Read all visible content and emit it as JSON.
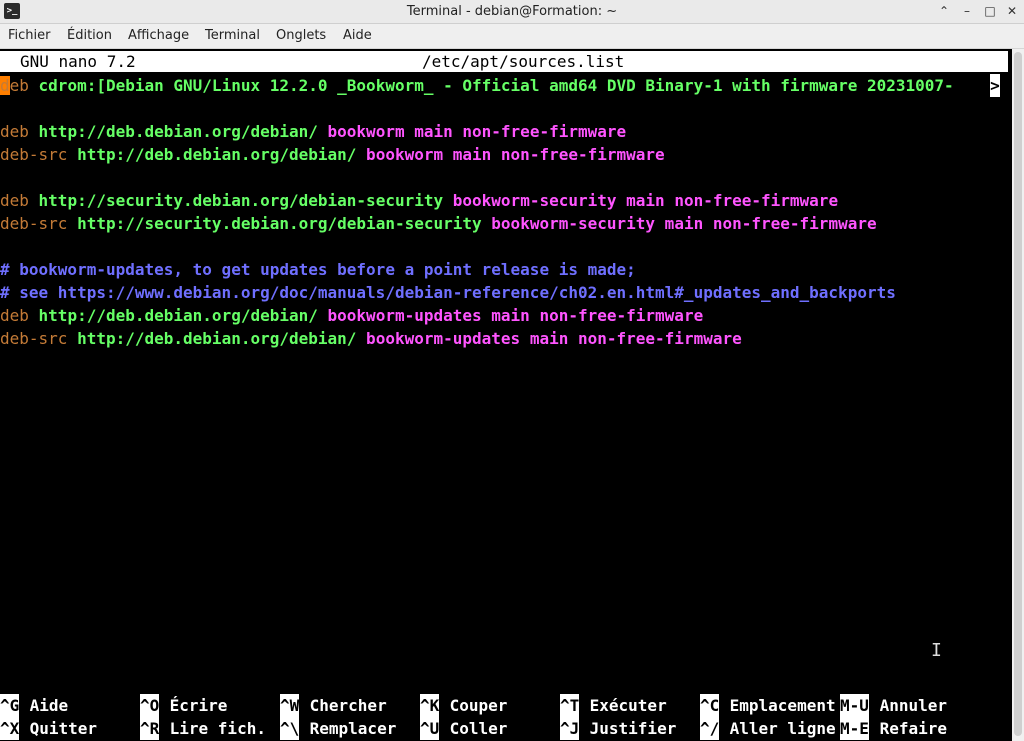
{
  "window": {
    "title": "Terminal - debian@Formation: ~",
    "app_icon": "terminal-icon",
    "buttons": {
      "minimize": "–",
      "maximize": "□",
      "close": "✕",
      "shade": "⌃"
    }
  },
  "menu": [
    "Fichier",
    "Édition",
    "Affichage",
    "Terminal",
    "Onglets",
    "Aide"
  ],
  "nano": {
    "version": "GNU nano 7.2",
    "file": "/etc/apt/sources.list",
    "lines": [
      {
        "type": "cd",
        "deb": "deb",
        "rest": " cdrom:[Debian GNU/Linux 12.2.0 _Bookworm_ - Official amd64 DVD Binary-1 with firmware 20231007-",
        "more": ">"
      },
      {
        "type": "blank"
      },
      {
        "type": "src",
        "kw": "deb",
        "url": " http://deb.debian.org/debian/",
        "suite": " bookworm main non-free-firmware"
      },
      {
        "type": "src",
        "kw": "deb-src",
        "url": " http://deb.debian.org/debian/",
        "suite": " bookworm main non-free-firmware"
      },
      {
        "type": "blank"
      },
      {
        "type": "src",
        "kw": "deb",
        "url": " http://security.debian.org/debian-security",
        "suite": " bookworm-security main non-free-firmware"
      },
      {
        "type": "src",
        "kw": "deb-src",
        "url": " http://security.debian.org/debian-security",
        "suite": " bookworm-security main non-free-firmware"
      },
      {
        "type": "blank"
      },
      {
        "type": "comment",
        "text": "# bookworm-updates, to get updates before a point release is made;"
      },
      {
        "type": "comment",
        "text": "# see https://www.debian.org/doc/manuals/debian-reference/ch02.en.html#_updates_and_backports"
      },
      {
        "type": "src",
        "kw": "deb",
        "url": " http://deb.debian.org/debian/",
        "suite": " bookworm-updates main non-free-firmware"
      },
      {
        "type": "src",
        "kw": "deb-src",
        "url": " http://deb.debian.org/debian/",
        "suite": " bookworm-updates main non-free-firmware"
      }
    ],
    "shortcuts_row1": [
      {
        "key": "^G",
        "label": " Aide"
      },
      {
        "key": "^O",
        "label": " Écrire"
      },
      {
        "key": "^W",
        "label": " Chercher"
      },
      {
        "key": "^K",
        "label": " Couper"
      },
      {
        "key": "^T",
        "label": " Exécuter"
      },
      {
        "key": "^C",
        "label": " Emplacement"
      },
      {
        "key": "M-U",
        "label": " Annuler"
      }
    ],
    "shortcuts_row2": [
      {
        "key": "^X",
        "label": " Quitter"
      },
      {
        "key": "^R",
        "label": " Lire fich."
      },
      {
        "key": "^\\",
        "label": " Remplacer"
      },
      {
        "key": "^U",
        "label": " Coller"
      },
      {
        "key": "^J",
        "label": " Justifier"
      },
      {
        "key": "^/",
        "label": " Aller ligne"
      },
      {
        "key": "M-E",
        "label": " Refaire"
      }
    ]
  },
  "colors": {
    "keyword": "#c47b37",
    "url": "#66ff66",
    "suite": "#ff55ff",
    "comment": "#6f6fff",
    "cursor": "#ff7f00"
  }
}
